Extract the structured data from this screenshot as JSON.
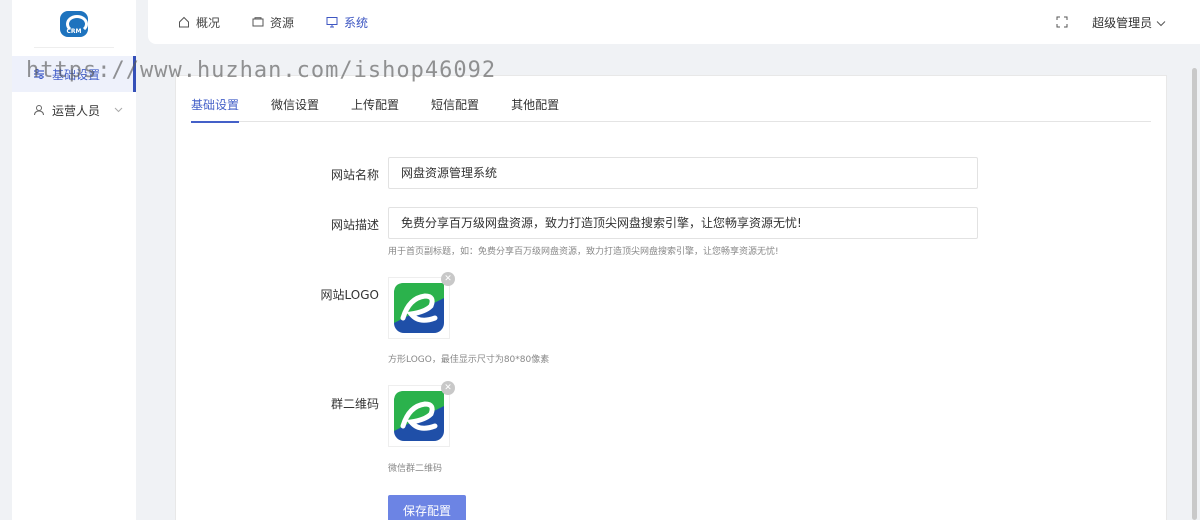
{
  "logo": {
    "text": "CRM"
  },
  "sidebar": {
    "items": [
      {
        "label": "基础设置",
        "icon": "sliders-icon",
        "active": true
      },
      {
        "label": "运营人员",
        "icon": "user-icon",
        "active": false
      }
    ]
  },
  "header": {
    "tabs": [
      {
        "label": "概况",
        "icon": "home-icon"
      },
      {
        "label": "资源",
        "icon": "folder-icon"
      },
      {
        "label": "系统",
        "icon": "monitor-icon",
        "active": true
      }
    ],
    "admin_label": "超级管理员"
  },
  "panel": {
    "tabs": [
      "基础设置",
      "微信设置",
      "上传配置",
      "短信配置",
      "其他配置"
    ],
    "active_tab": "基础设置"
  },
  "form": {
    "site_name": {
      "label": "网站名称",
      "value": "网盘资源管理系统"
    },
    "site_desc": {
      "label": "网站描述",
      "value": "免费分享百万级网盘资源，致力打造顶尖网盘搜索引擎，让您畅享资源无忧!",
      "hint": "用于首页副标题，如：免费分享百万级网盘资源，致力打造顶尖网盘搜索引擎，让您畅享资源无忧!"
    },
    "site_logo": {
      "label": "网站LOGO",
      "hint": "方形LOGO，最佳显示尺寸为80*80像素"
    },
    "group_qr": {
      "label": "群二维码",
      "hint": "微信群二维码"
    },
    "save_label": "保存配置",
    "delete_glyph": "✕"
  },
  "watermark": "https://www.huzhan.com/ishop46092",
  "colors": {
    "accent": "#4460c8",
    "button": "#6c84e4",
    "logo_green": "#2bb24c",
    "logo_blue": "#1f4fa8"
  }
}
